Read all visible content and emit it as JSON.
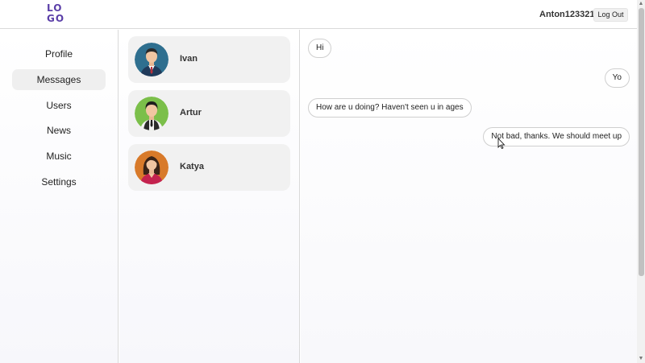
{
  "header": {
    "logo_top": "LO",
    "logo_bottom": "GO",
    "username": "Anton123321",
    "logout_label": "Log Out"
  },
  "sidebar": {
    "items": [
      {
        "label": "Profile"
      },
      {
        "label": "Messages",
        "active": true
      },
      {
        "label": "Users"
      },
      {
        "label": "News"
      },
      {
        "label": "Music"
      },
      {
        "label": "Settings"
      }
    ]
  },
  "conversations": [
    {
      "name": "Ivan",
      "avatar_color": "#2f6f8f"
    },
    {
      "name": "Artur",
      "avatar_color": "#7bbf4a"
    },
    {
      "name": "Katya",
      "avatar_color": "#d87a2a"
    }
  ],
  "chat": {
    "messages": [
      {
        "text": "Hi",
        "side": "left"
      },
      {
        "text": "Yo",
        "side": "right"
      },
      {
        "text": "How are u doing? Haven't seen u in ages",
        "side": "left"
      },
      {
        "text": "Not bad, thanks. We should meet up",
        "side": "right"
      }
    ]
  },
  "colors": {
    "brand": "#5b3fa8",
    "border": "#d9d9d9",
    "card": "#f1f1f1"
  },
  "icons": {
    "scroll_up": "scroll-up-arrow-icon",
    "scroll_down": "scroll-down-arrow-icon",
    "cursor": "mouse-pointer-icon"
  }
}
